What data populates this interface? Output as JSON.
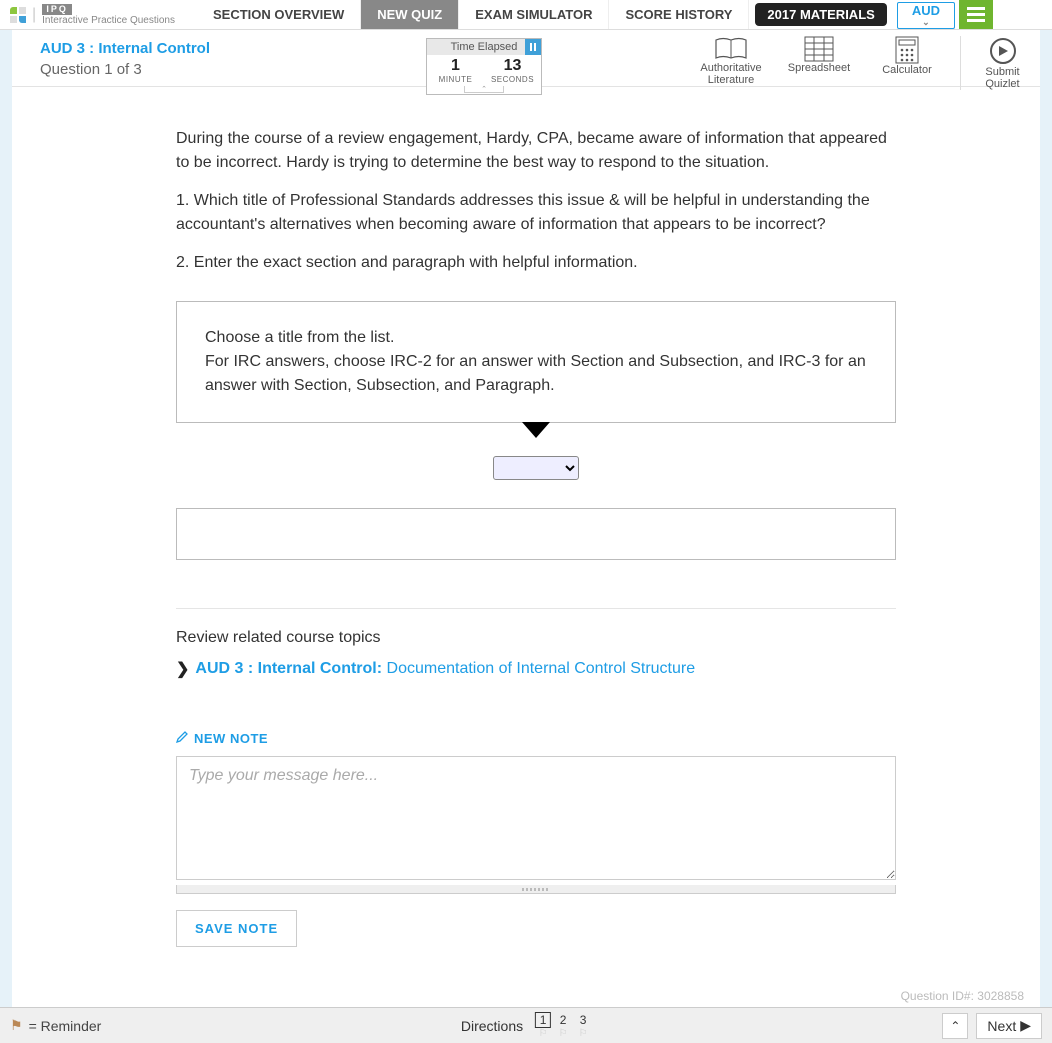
{
  "brand": {
    "ipq": "IPQ",
    "subtitle": "Interactive Practice Questions"
  },
  "nav": {
    "tabs": [
      "SECTION OVERVIEW",
      "NEW QUIZ",
      "EXAM SIMULATOR",
      "SCORE HISTORY"
    ],
    "active_index": 1,
    "materials": "2017 MATERIALS",
    "exam_code": "AUD"
  },
  "subheader": {
    "section_title": "AUD 3 : Internal Control",
    "question_counter": "Question 1 of 3"
  },
  "timer": {
    "label": "Time Elapsed",
    "minutes": "1",
    "minutes_lbl": "MINUTE",
    "seconds": "13",
    "seconds_lbl": "SECONDS"
  },
  "tools": {
    "auth_lit": "Authoritative Literature",
    "spreadsheet": "Spreadsheet",
    "calculator": "Calculator",
    "submit": "Submit Quizlet"
  },
  "question": {
    "intro": "During the course of a review engagement, Hardy, CPA, became aware of information that appeared to be incorrect. Hardy is trying to determine the best way to respond to the situation.",
    "part1": "1. Which title of Professional Standards addresses this issue & will be helpful in understanding the accountant's alternatives when becoming aware of information that appears to be incorrect?",
    "part2": "2. Enter the exact section and paragraph with helpful information.",
    "choose_title": "Choose a title from the list.",
    "choose_help": "For IRC answers, choose IRC-2 for an answer with Section and Subsection, and IRC-3 for an answer with Section, Subsection, and Paragraph."
  },
  "related": {
    "heading": "Review related course topics",
    "link_bold": "AUD 3 : Internal Control:",
    "link_rest": " Documentation of Internal Control Structure"
  },
  "note": {
    "heading": "NEW NOTE",
    "placeholder": "Type your message here...",
    "save": "SAVE NOTE"
  },
  "meta": {
    "question_id_label": "Question ID#: ",
    "question_id": "3028858"
  },
  "footer": {
    "reminder": " = Reminder",
    "directions": "Directions",
    "questions": [
      "1",
      "2",
      "3"
    ],
    "current_q": 0,
    "next": "Next"
  }
}
